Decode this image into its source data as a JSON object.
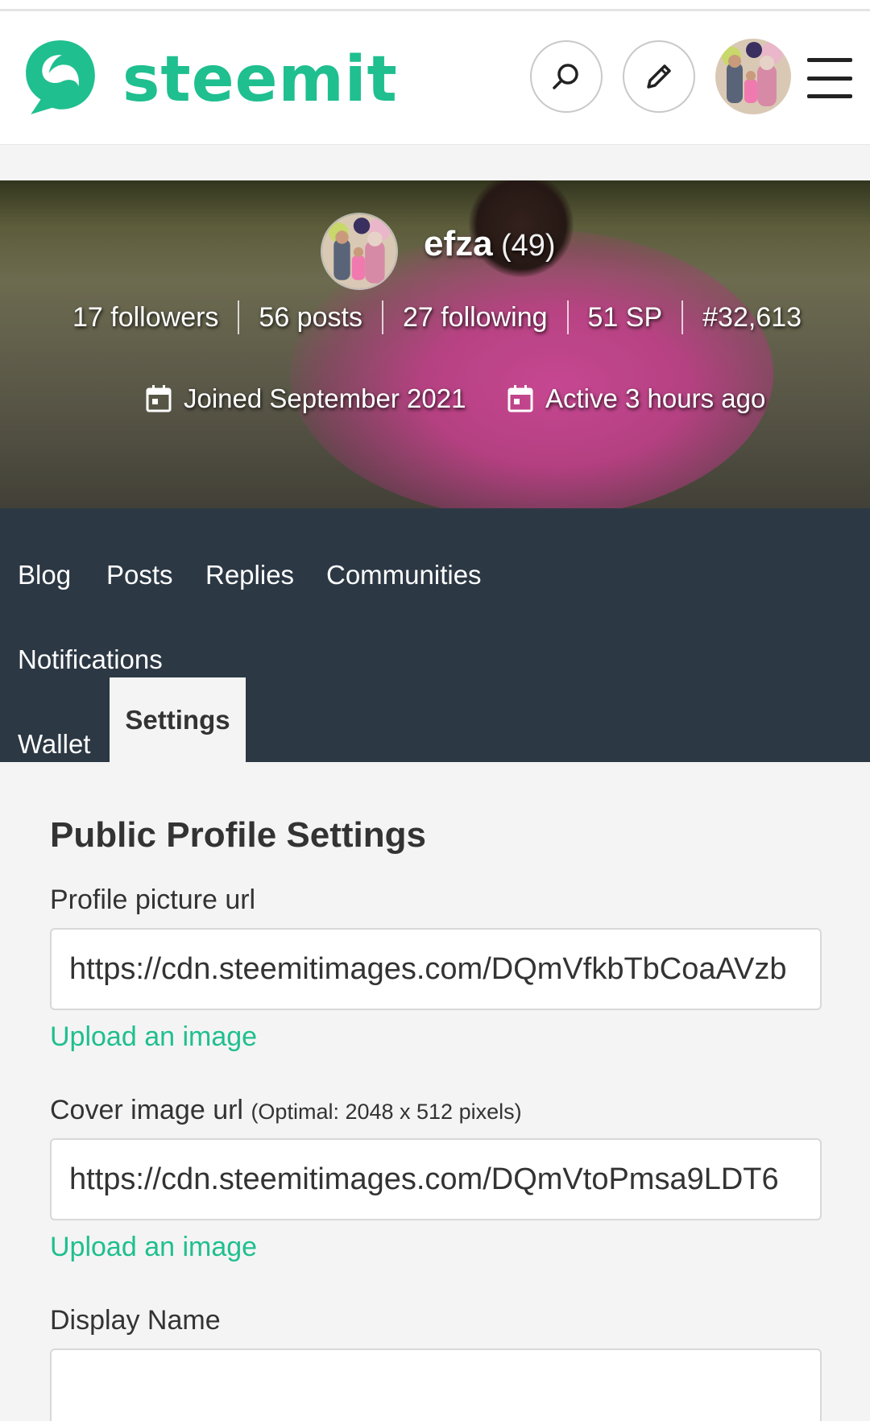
{
  "brand": {
    "name": "steemit",
    "color": "#1fbf8f"
  },
  "header": {
    "search_icon": "search-icon",
    "edit_icon": "pencil-icon",
    "menu_icon": "hamburger-menu-icon"
  },
  "profile": {
    "username": "efza",
    "reputation": "(49)",
    "stats": {
      "followers": "17 followers",
      "posts": "56 posts",
      "following": "27 following",
      "steem_power": "51 SP",
      "rank": "#32,613"
    },
    "joined": "Joined September 2021",
    "active": "Active 3 hours ago"
  },
  "tabs": {
    "blog": "Blog",
    "posts": "Posts",
    "replies": "Replies",
    "communities": "Communities",
    "notifications": "Notifications",
    "wallet": "Wallet",
    "settings": "Settings",
    "active_tab": "Settings"
  },
  "settings": {
    "title": "Public Profile Settings",
    "profile_picture_label": "Profile picture url",
    "profile_picture_value": "https://cdn.steemitimages.com/DQmVfkbTbCoaAVzb",
    "upload_link_1": "Upload an image",
    "cover_image_label": "Cover image url",
    "cover_image_hint": "(Optimal: 2048 x 512 pixels)",
    "cover_image_value": "https://cdn.steemitimages.com/DQmVtoPmsa9LDT6",
    "upload_link_2": "Upload an image",
    "display_name_label": "Display Name",
    "display_name_value": ""
  },
  "colors": {
    "tabbar_bg": "#2c3844",
    "page_bg": "#f4f4f4",
    "link": "#1fbf8f"
  }
}
